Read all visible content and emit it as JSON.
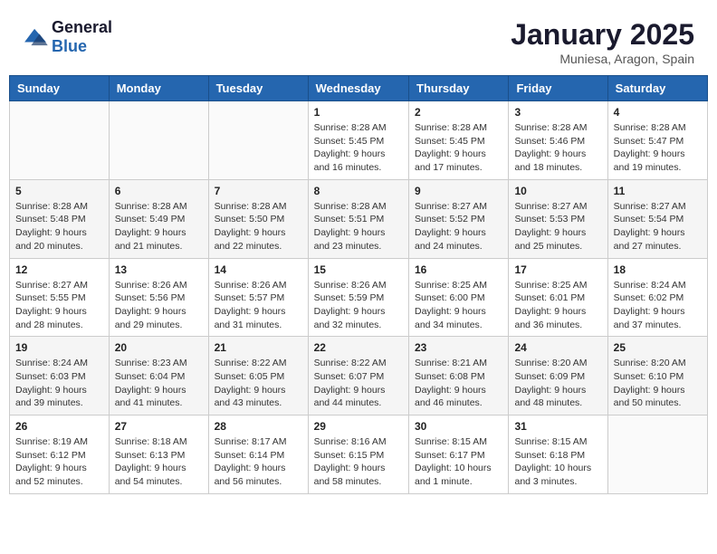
{
  "header": {
    "logo": {
      "general": "General",
      "blue": "Blue"
    },
    "title": "January 2025",
    "location": "Muniesa, Aragon, Spain"
  },
  "weekdays": [
    "Sunday",
    "Monday",
    "Tuesday",
    "Wednesday",
    "Thursday",
    "Friday",
    "Saturday"
  ],
  "weeks": [
    [
      {
        "day": "",
        "info": ""
      },
      {
        "day": "",
        "info": ""
      },
      {
        "day": "",
        "info": ""
      },
      {
        "day": "1",
        "info": "Sunrise: 8:28 AM\nSunset: 5:45 PM\nDaylight: 9 hours\nand 16 minutes."
      },
      {
        "day": "2",
        "info": "Sunrise: 8:28 AM\nSunset: 5:45 PM\nDaylight: 9 hours\nand 17 minutes."
      },
      {
        "day": "3",
        "info": "Sunrise: 8:28 AM\nSunset: 5:46 PM\nDaylight: 9 hours\nand 18 minutes."
      },
      {
        "day": "4",
        "info": "Sunrise: 8:28 AM\nSunset: 5:47 PM\nDaylight: 9 hours\nand 19 minutes."
      }
    ],
    [
      {
        "day": "5",
        "info": "Sunrise: 8:28 AM\nSunset: 5:48 PM\nDaylight: 9 hours\nand 20 minutes."
      },
      {
        "day": "6",
        "info": "Sunrise: 8:28 AM\nSunset: 5:49 PM\nDaylight: 9 hours\nand 21 minutes."
      },
      {
        "day": "7",
        "info": "Sunrise: 8:28 AM\nSunset: 5:50 PM\nDaylight: 9 hours\nand 22 minutes."
      },
      {
        "day": "8",
        "info": "Sunrise: 8:28 AM\nSunset: 5:51 PM\nDaylight: 9 hours\nand 23 minutes."
      },
      {
        "day": "9",
        "info": "Sunrise: 8:27 AM\nSunset: 5:52 PM\nDaylight: 9 hours\nand 24 minutes."
      },
      {
        "day": "10",
        "info": "Sunrise: 8:27 AM\nSunset: 5:53 PM\nDaylight: 9 hours\nand 25 minutes."
      },
      {
        "day": "11",
        "info": "Sunrise: 8:27 AM\nSunset: 5:54 PM\nDaylight: 9 hours\nand 27 minutes."
      }
    ],
    [
      {
        "day": "12",
        "info": "Sunrise: 8:27 AM\nSunset: 5:55 PM\nDaylight: 9 hours\nand 28 minutes."
      },
      {
        "day": "13",
        "info": "Sunrise: 8:26 AM\nSunset: 5:56 PM\nDaylight: 9 hours\nand 29 minutes."
      },
      {
        "day": "14",
        "info": "Sunrise: 8:26 AM\nSunset: 5:57 PM\nDaylight: 9 hours\nand 31 minutes."
      },
      {
        "day": "15",
        "info": "Sunrise: 8:26 AM\nSunset: 5:59 PM\nDaylight: 9 hours\nand 32 minutes."
      },
      {
        "day": "16",
        "info": "Sunrise: 8:25 AM\nSunset: 6:00 PM\nDaylight: 9 hours\nand 34 minutes."
      },
      {
        "day": "17",
        "info": "Sunrise: 8:25 AM\nSunset: 6:01 PM\nDaylight: 9 hours\nand 36 minutes."
      },
      {
        "day": "18",
        "info": "Sunrise: 8:24 AM\nSunset: 6:02 PM\nDaylight: 9 hours\nand 37 minutes."
      }
    ],
    [
      {
        "day": "19",
        "info": "Sunrise: 8:24 AM\nSunset: 6:03 PM\nDaylight: 9 hours\nand 39 minutes."
      },
      {
        "day": "20",
        "info": "Sunrise: 8:23 AM\nSunset: 6:04 PM\nDaylight: 9 hours\nand 41 minutes."
      },
      {
        "day": "21",
        "info": "Sunrise: 8:22 AM\nSunset: 6:05 PM\nDaylight: 9 hours\nand 43 minutes."
      },
      {
        "day": "22",
        "info": "Sunrise: 8:22 AM\nSunset: 6:07 PM\nDaylight: 9 hours\nand 44 minutes."
      },
      {
        "day": "23",
        "info": "Sunrise: 8:21 AM\nSunset: 6:08 PM\nDaylight: 9 hours\nand 46 minutes."
      },
      {
        "day": "24",
        "info": "Sunrise: 8:20 AM\nSunset: 6:09 PM\nDaylight: 9 hours\nand 48 minutes."
      },
      {
        "day": "25",
        "info": "Sunrise: 8:20 AM\nSunset: 6:10 PM\nDaylight: 9 hours\nand 50 minutes."
      }
    ],
    [
      {
        "day": "26",
        "info": "Sunrise: 8:19 AM\nSunset: 6:12 PM\nDaylight: 9 hours\nand 52 minutes."
      },
      {
        "day": "27",
        "info": "Sunrise: 8:18 AM\nSunset: 6:13 PM\nDaylight: 9 hours\nand 54 minutes."
      },
      {
        "day": "28",
        "info": "Sunrise: 8:17 AM\nSunset: 6:14 PM\nDaylight: 9 hours\nand 56 minutes."
      },
      {
        "day": "29",
        "info": "Sunrise: 8:16 AM\nSunset: 6:15 PM\nDaylight: 9 hours\nand 58 minutes."
      },
      {
        "day": "30",
        "info": "Sunrise: 8:15 AM\nSunset: 6:17 PM\nDaylight: 10 hours\nand 1 minute."
      },
      {
        "day": "31",
        "info": "Sunrise: 8:15 AM\nSunset: 6:18 PM\nDaylight: 10 hours\nand 3 minutes."
      },
      {
        "day": "",
        "info": ""
      }
    ]
  ]
}
